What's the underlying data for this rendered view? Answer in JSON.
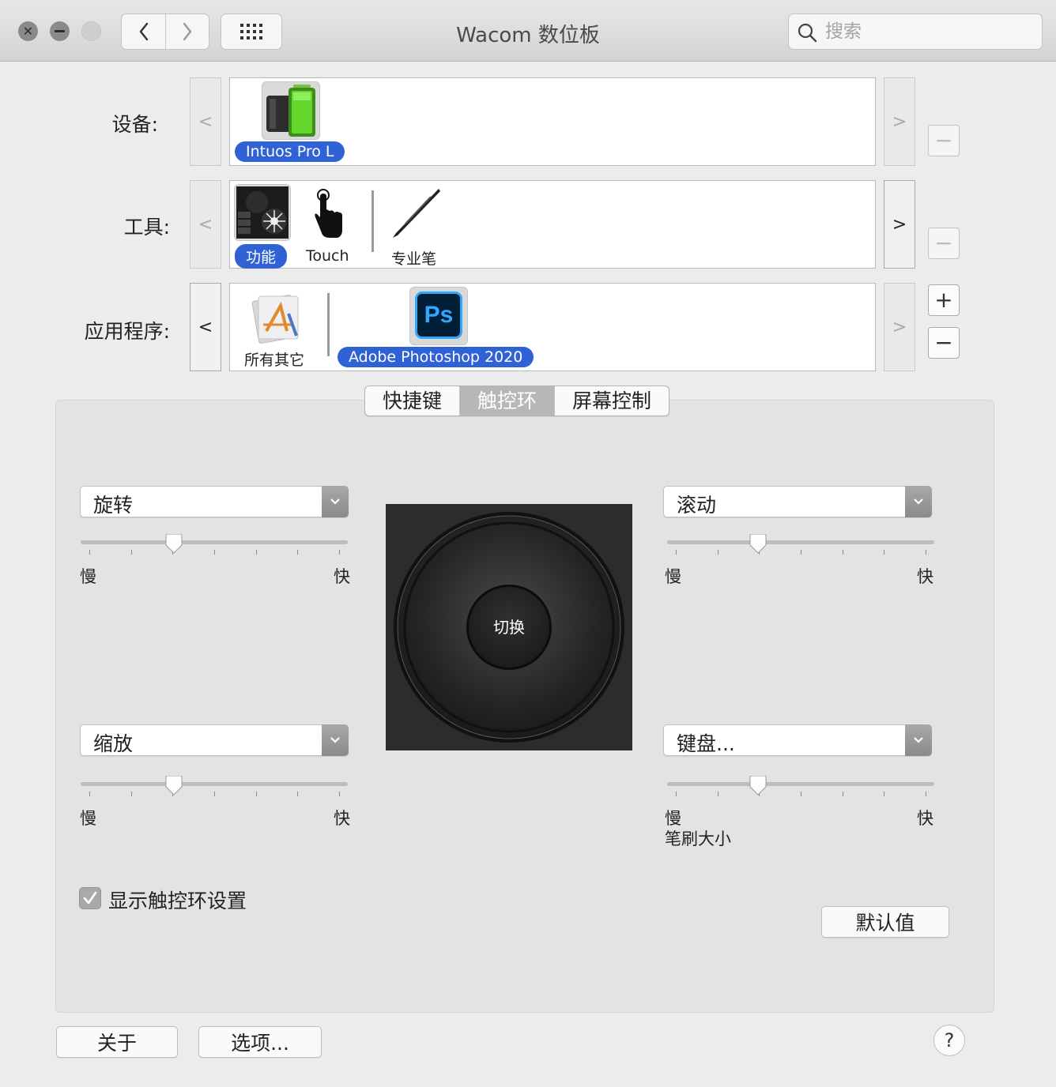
{
  "window": {
    "title": "Wacom 数位板"
  },
  "search": {
    "placeholder": "搜索"
  },
  "device_row": {
    "label": "设备:",
    "items": [
      {
        "label": "Intuos Pro L"
      }
    ]
  },
  "tool_row": {
    "label": "工具:",
    "items": [
      {
        "label": "功能"
      },
      {
        "label": "Touch"
      },
      {
        "label": "专业笔"
      }
    ]
  },
  "app_row": {
    "label": "应用程序:",
    "items": [
      {
        "label": "所有其它"
      },
      {
        "label": "Adobe Photoshop 2020",
        "icon_text": "Ps"
      }
    ]
  },
  "arrows": {
    "left": "<",
    "right": ">"
  },
  "buttons": {
    "add": "+",
    "remove": "−"
  },
  "tabs": [
    {
      "label": "快捷键"
    },
    {
      "label": "触控环",
      "selected": true
    },
    {
      "label": "屏幕控制"
    }
  ],
  "ring_settings": [
    {
      "mode": "旋转",
      "min_label": "慢",
      "max_label": "快",
      "speed": 0.35
    },
    {
      "mode": "滚动",
      "min_label": "慢",
      "max_label": "快",
      "speed": 0.34
    },
    {
      "mode": "缩放",
      "min_label": "慢",
      "max_label": "快",
      "speed": 0.35
    },
    {
      "mode": "键盘...",
      "min_label": "慢",
      "max_label": "快",
      "speed": 0.34,
      "sub_label": "笔刷大小"
    }
  ],
  "ring_center_label": "切换",
  "show_ring_settings": {
    "label": "显示触控环设置",
    "checked": true
  },
  "default_button": "默认值",
  "about_button": "关于",
  "options_button": "选项...",
  "help_button": "?"
}
